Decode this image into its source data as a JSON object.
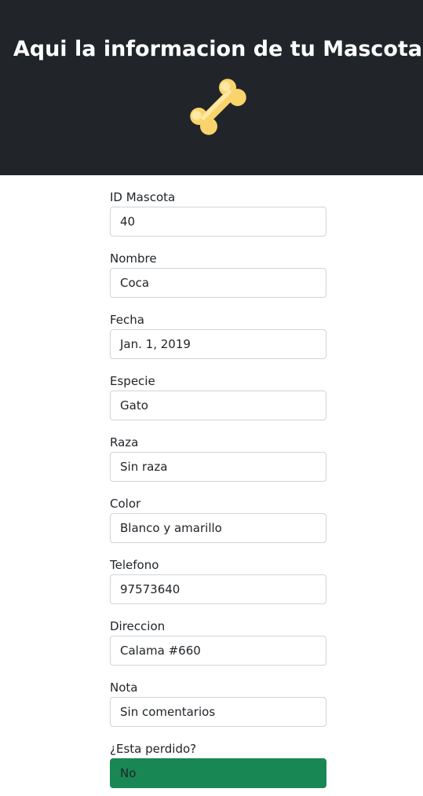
{
  "header": {
    "title": "Aqui la informacion de tu Mascota",
    "icon": "bone-icon",
    "bone_color": "#f9d46c",
    "background": "#212529"
  },
  "form": {
    "fields": [
      {
        "label": "ID Mascota",
        "value": "40"
      },
      {
        "label": "Nombre",
        "value": "Coca"
      },
      {
        "label": "Fecha",
        "value": "Jan. 1, 2019"
      },
      {
        "label": "Especie",
        "value": "Gato"
      },
      {
        "label": "Raza",
        "value": "Sin raza"
      },
      {
        "label": "Color",
        "value": "Blanco y amarillo"
      },
      {
        "label": "Telefono",
        "value": "97573640"
      },
      {
        "label": "Direccion",
        "value": "Calama #660"
      },
      {
        "label": "Nota",
        "value": "Sin comentarios"
      },
      {
        "label": "¿Esta perdido?",
        "value": "No",
        "status_color": "#198754"
      }
    ]
  }
}
